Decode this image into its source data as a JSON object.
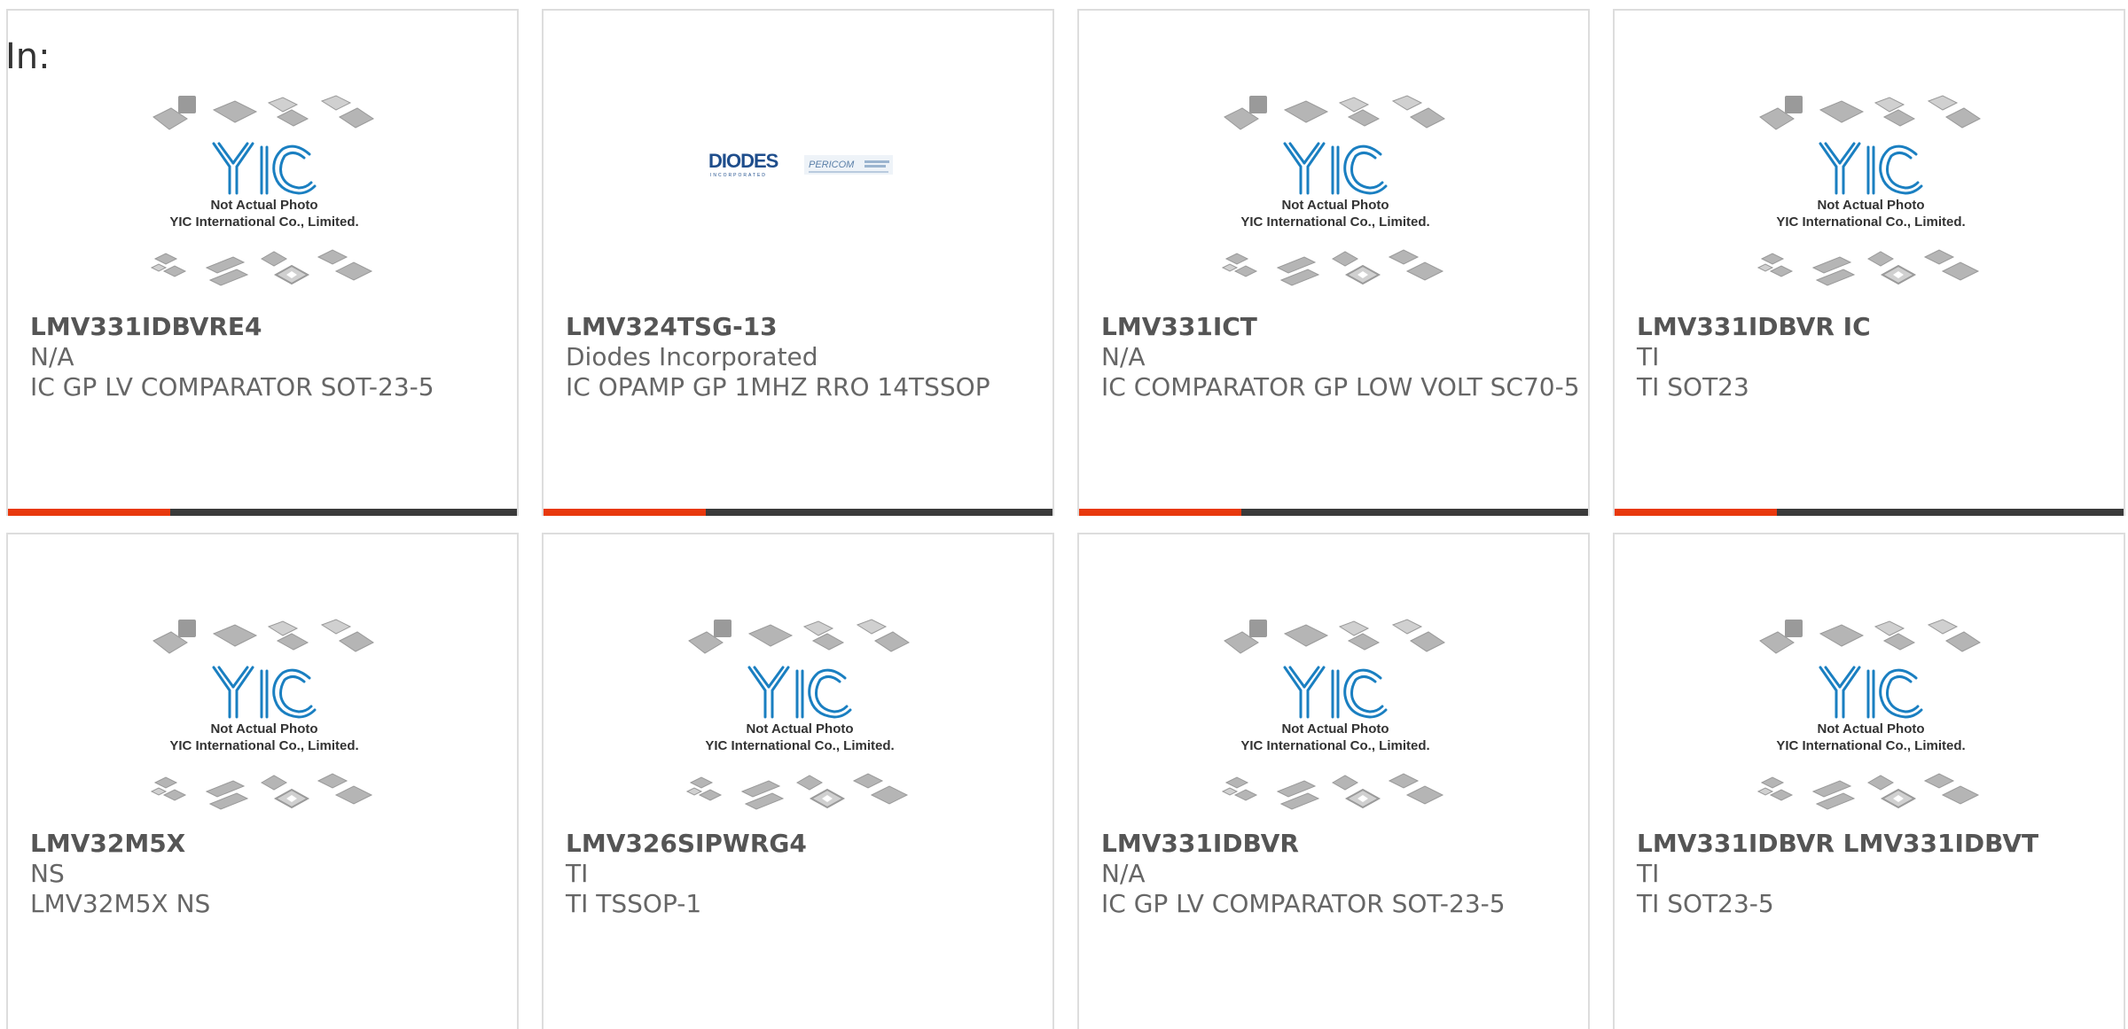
{
  "header": {
    "in_label": "In:"
  },
  "placeholder_photo": {
    "line1": "Not Actual Photo",
    "line2": "YIC International Co., Limited."
  },
  "diodes_logo": {
    "brand": "DIODES",
    "brand_sub": "INCORPORATED",
    "partner": "PERICOM"
  },
  "colors": {
    "accent": "#e8380d",
    "bar": "#3a3a3a",
    "yic_blue": "#1a7fc1"
  },
  "products": [
    {
      "part": "LMV331IDBVRE4",
      "maker": "N/A",
      "desc": "IC GP LV COMPARATOR SOT-23-5",
      "image": "yic-placeholder"
    },
    {
      "part": "LMV324TSG-13",
      "maker": "Diodes Incorporated",
      "desc": "IC OPAMP GP 1MHZ RRO 14TSSOP",
      "image": "diodes-logo"
    },
    {
      "part": "LMV331ICT",
      "maker": "N/A",
      "desc": "IC COMPARATOR GP LOW VOLT SC70-5",
      "image": "yic-placeholder"
    },
    {
      "part": "LMV331IDBVR IC",
      "maker": "TI",
      "desc": "TI SOT23",
      "image": "yic-placeholder"
    },
    {
      "part": "LMV32M5X",
      "maker": "NS",
      "desc": "LMV32M5X NS",
      "image": "yic-placeholder"
    },
    {
      "part": "LMV326SIPWRG4",
      "maker": "TI",
      "desc": "TI TSSOP-1",
      "image": "yic-placeholder"
    },
    {
      "part": "LMV331IDBVR",
      "maker": "N/A",
      "desc": "IC GP LV COMPARATOR SOT-23-5",
      "image": "yic-placeholder"
    },
    {
      "part": "LMV331IDBVR LMV331IDBVT",
      "maker": "TI",
      "desc": "TI SOT23-5",
      "image": "yic-placeholder"
    }
  ]
}
